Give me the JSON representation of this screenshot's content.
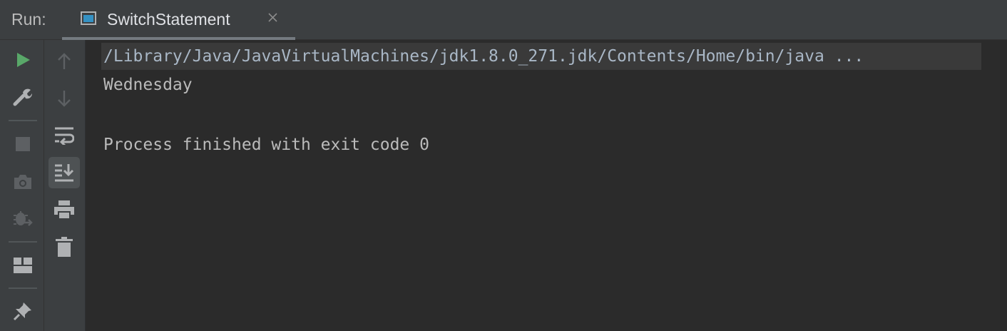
{
  "header": {
    "run_label": "Run:",
    "tab_title": "SwitchStatement",
    "tab_icon": "console-icon",
    "close_icon": "close-icon"
  },
  "toolbar_outer": [
    {
      "name": "rerun-button",
      "icon": "play-icon",
      "color": "#59a869"
    },
    {
      "name": "edit-configuration-button",
      "icon": "wrench-icon"
    },
    {
      "name": "stop-button",
      "icon": "stop-icon",
      "disabled": true
    },
    {
      "name": "dump-threads-button",
      "icon": "camera-icon",
      "disabled": true
    },
    {
      "name": "exit-debug-button",
      "icon": "bug-exit-icon",
      "disabled": true
    },
    {
      "name": "restore-layout-button",
      "icon": "layout-icon"
    },
    {
      "name": "pin-tab-button",
      "icon": "pin-icon"
    }
  ],
  "toolbar_inner": [
    {
      "name": "previous-occurrence-button",
      "icon": "arrow-up-icon",
      "disabled": true
    },
    {
      "name": "next-occurrence-button",
      "icon": "arrow-down-icon",
      "disabled": true
    },
    {
      "name": "soft-wrap-button",
      "icon": "soft-wrap-icon"
    },
    {
      "name": "scroll-to-end-button",
      "icon": "scroll-to-end-icon",
      "active": true
    },
    {
      "name": "print-button",
      "icon": "printer-icon"
    },
    {
      "name": "clear-all-button",
      "icon": "trash-icon"
    }
  ],
  "console": {
    "command_line": "/Library/Java/JavaVirtualMachines/jdk1.8.0_271.jdk/Contents/Home/bin/java ...",
    "output_lines": [
      "Wednesday",
      "",
      "Process finished with exit code 0"
    ]
  },
  "colors": {
    "background": "#2b2b2b",
    "toolbar": "#3c3f41",
    "run_green": "#59a869"
  }
}
